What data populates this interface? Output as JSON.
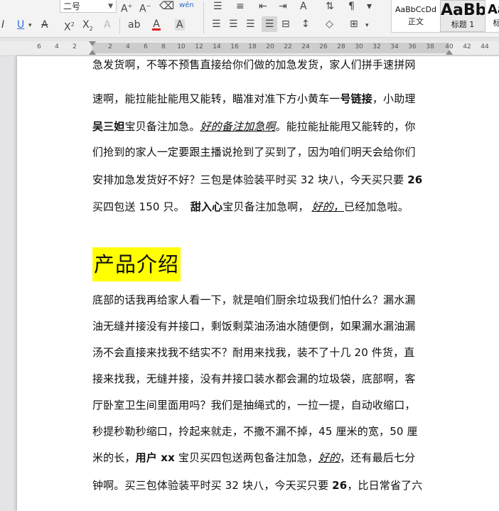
{
  "toolbar": {
    "font_size": "二号",
    "style_gallery": [
      {
        "sample": "AaBbCcDd",
        "caption": "正文"
      },
      {
        "sample": "AaBb",
        "caption": "标题 1"
      },
      {
        "sample": "Aa",
        "caption": "标"
      }
    ],
    "icons": [
      "increase-font-icon",
      "decrease-font-icon",
      "clear-format-icon",
      "phonetic-guide-icon",
      "bullets-icon",
      "numbering-icon",
      "decrease-indent-icon",
      "increase-indent-icon",
      "text-direction-icon",
      "sort-icon",
      "show-marks-icon",
      "italic-icon",
      "underline-icon",
      "strikethrough-icon",
      "superscript-icon",
      "subscript-icon",
      "text-effect-icon",
      "highlight-icon",
      "font-color-icon",
      "char-shading-icon",
      "align-left-icon",
      "align-center-icon",
      "align-right-icon",
      "justify-icon",
      "distributed-icon",
      "line-spacing-icon",
      "shading-icon",
      "borders-icon"
    ]
  },
  "ruler": {
    "numbers": [
      "6",
      "4",
      "2",
      "2",
      "4",
      "6",
      "8",
      "10",
      "12",
      "14",
      "16",
      "18",
      "20",
      "22",
      "24",
      "26",
      "28",
      "30",
      "32",
      "34",
      "36",
      "38",
      "40",
      "42",
      "44"
    ]
  },
  "document": {
    "p1": {
      "l1": "急发货啊，不等不预售直接给你们做的加急发货，家人们拼手速拼网",
      "l2a": "速啊，能拉能扯能甩又能转，瞄准对准下方小黄车一",
      "l2b": "号链接",
      "l2c": "，小助理",
      "l3a": "吴三妲",
      "l3b": "宝贝备注加急。",
      "l3c": "好的备注加急啊",
      "l3d": "。能拉能扯能甩又能转的，你",
      "l4": "们抢到的家人一定要跟主播说抢到了买到了，因为咱们明天会给你们",
      "l5a": "安排加急发货好不好？三包是体验装平时买 32 块八，今天买只要 ",
      "l5b": "26",
      "l6a": "买四包送 150 只。",
      "l6b": "甜入心",
      "l6c": "宝贝备注加急啊，",
      "l6d": "好的，",
      "l6e": "已经加急啦。"
    },
    "heading": "产品介绍",
    "p2": {
      "l1": "底部的话我再给家人看一下，就是咱们厨余垃圾我们怕什么？漏水漏",
      "l2": "油无缝并接没有并接口，剩饭剩菜油汤油水随便倒，如果漏水漏油漏",
      "l3": "汤不会直接来找我不结实不？耐用来找我，装不了十几 20 件货，直",
      "l4": "接来找我，无缝并接，没有并接口装水都会漏的垃圾袋，底部啊，客",
      "l5": "厅卧室卫生间里面用吗？我们是抽绳式的，一拉一提，自动收缩口，",
      "l6": "秒提秒勒秒缩口，拎起来就走，不撒不漏不掉，45 厘米的宽，50 厘",
      "l7a": "米的长，",
      "l7b": "用户 xx",
      "l7c": " 宝贝买四包送两包备注加急，",
      "l7d": "好的",
      "l7e": "，还有最后七分",
      "l8a": "钟啊。买三包体验装平时买 32 块八，今天买只要 ",
      "l8b": "26",
      "l8c": "，比日常省了六"
    }
  },
  "colors": {
    "highlight": "#ffff00",
    "font_color_bar": "#e02020",
    "underline_accent": "#2f6fd8",
    "ribbon_bg": "#f3f3f3"
  }
}
